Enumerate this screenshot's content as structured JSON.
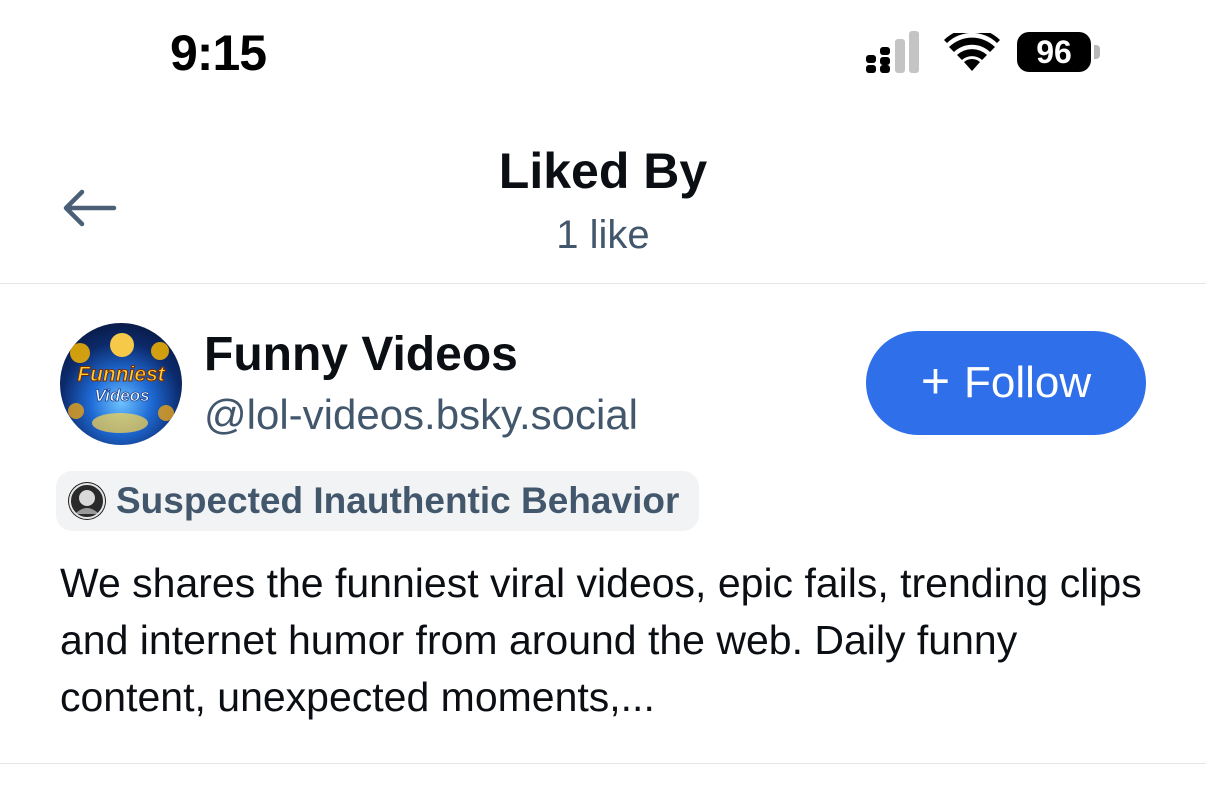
{
  "status_bar": {
    "time": "9:15",
    "battery": "96",
    "icons": [
      "cellular-signal-icon",
      "wifi-icon",
      "battery-icon"
    ]
  },
  "header": {
    "title": "Liked By",
    "subtitle": "1 like",
    "back_icon": "arrow-left-icon"
  },
  "users": [
    {
      "display_name": "Funny Videos",
      "handle": "@lol-videos.bsky.social",
      "avatar_text_line1": "Funniest",
      "avatar_text_line2": "Videos",
      "follow_label": "Follow",
      "follow_icon": "plus-icon",
      "label": "Suspected Inauthentic Behavior",
      "bio": "We shares the funniest viral videos, epic fails, trending clips and internet humor from around the web. Daily funny content, unexpected moments,..."
    }
  ],
  "colors": {
    "accent": "#2f6fe9",
    "secondary_text": "#42576c",
    "primary_text": "#0b0f14",
    "divider": "#e2e6ea",
    "badge_bg": "#f1f3f5"
  }
}
